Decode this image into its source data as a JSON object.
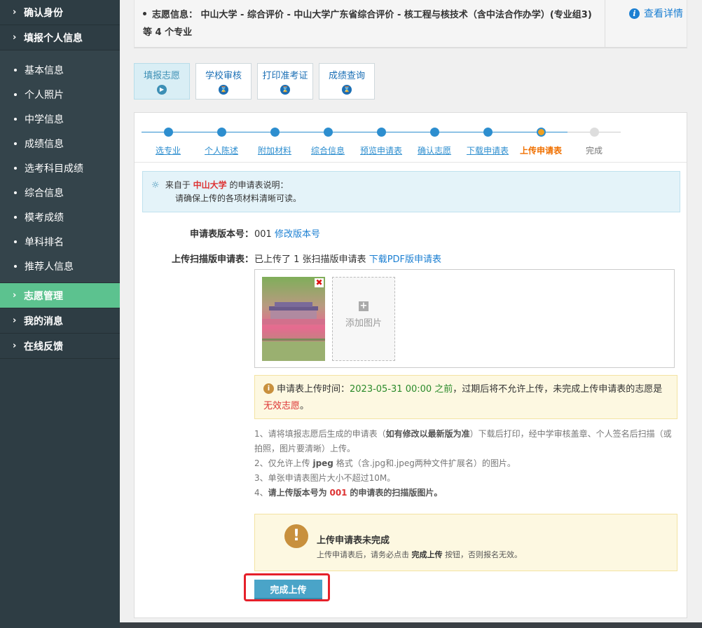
{
  "sidebar": {
    "top_sections": [
      {
        "label": "确认身份"
      },
      {
        "label": "填报个人信息"
      }
    ],
    "sub_items": [
      {
        "label": "基本信息"
      },
      {
        "label": "个人照片"
      },
      {
        "label": "中学信息"
      },
      {
        "label": "成绩信息"
      },
      {
        "label": "选考科目成绩"
      },
      {
        "label": "综合信息"
      },
      {
        "label": "模考成绩"
      },
      {
        "label": "单科排名"
      },
      {
        "label": "推荐人信息"
      }
    ],
    "bottom_sections": [
      {
        "label": "志愿管理",
        "active": true
      },
      {
        "label": "我的消息"
      },
      {
        "label": "在线反馈"
      }
    ],
    "chevron": "›"
  },
  "info": {
    "text": "志愿信息： 中山大学 - 综合评价 - 中山大学广东省综合评价 - 核工程与核技术（含中法合作办学）(专业组3) 等 4 个专业",
    "detail_link": "查看详情"
  },
  "tabs": [
    {
      "label": "填报志愿",
      "active": true
    },
    {
      "label": "学校审核"
    },
    {
      "label": "打印准考证"
    },
    {
      "label": "成绩查询"
    }
  ],
  "steps": [
    {
      "label": "选专业",
      "state": "done"
    },
    {
      "label": "个人陈述",
      "state": "done"
    },
    {
      "label": "附加材料",
      "state": "done"
    },
    {
      "label": "综合信息",
      "state": "done"
    },
    {
      "label": "预览申请表",
      "state": "done"
    },
    {
      "label": "确认志愿",
      "state": "done"
    },
    {
      "label": "下载申请表",
      "state": "done"
    },
    {
      "label": "上传申请表",
      "state": "current"
    },
    {
      "label": "完成",
      "state": "todo"
    }
  ],
  "notice": {
    "prefix": "来自于",
    "org": "中山大学",
    "suffix": "的申请表说明：",
    "line2": "请确保上传的各项材料清晰可读。"
  },
  "form": {
    "version_label": "申请表版本号：",
    "version_value": "001",
    "version_link": "修改版本号",
    "upload_label": "上传扫描版申请表：",
    "upload_value": "已上传了 1 张扫描版申请表",
    "upload_link": "下载PDF版申请表",
    "add_image": "添加图片",
    "delete_glyph": "✖",
    "plus_glyph": "+"
  },
  "deadline": {
    "prefix": "申请表上传时间：",
    "time": "2023-05-31 00:00 之前",
    "middle": "，过期后将不允许上传，未完成上传申请表的志愿是",
    "invalid": "无效志愿",
    "end": "。"
  },
  "rules": {
    "r1_a": "1、请将填报志愿后生成的申请表（",
    "r1_b": "如有修改以最新版为准",
    "r1_c": "）下载后打印，经中学审核盖章、个人签名后扫描（或拍照，图片要清晰）上传。",
    "r2_a": "2、仅允许上传",
    "r2_b": "jpeg",
    "r2_c": "格式（含.jpg和.jpeg两种文件扩展名）的图片。",
    "r3": "3、单张申请表图片大小不超过10M。",
    "r4_a": "4、",
    "r4_b": "请上传版本号为",
    "r4_c": "001",
    "r4_d": "的申请表的扫描版图片。"
  },
  "alert": {
    "title": "上传申请表未完成",
    "desc_a": "上传申请表后，请务必点击",
    "desc_b": "完成上传",
    "desc_c": "按钮，否则报名无效。",
    "glyph": "!"
  },
  "finish_button": "完成上传",
  "colors": {
    "sidebar_bg": "#2e3d44",
    "sidebar_active": "#5cc28f",
    "link_blue": "#1b7fd2",
    "step_blue": "#2d8ecf",
    "current_orange": "#f07000",
    "warn_red": "#d33333",
    "highlight_border": "#e5202a"
  }
}
